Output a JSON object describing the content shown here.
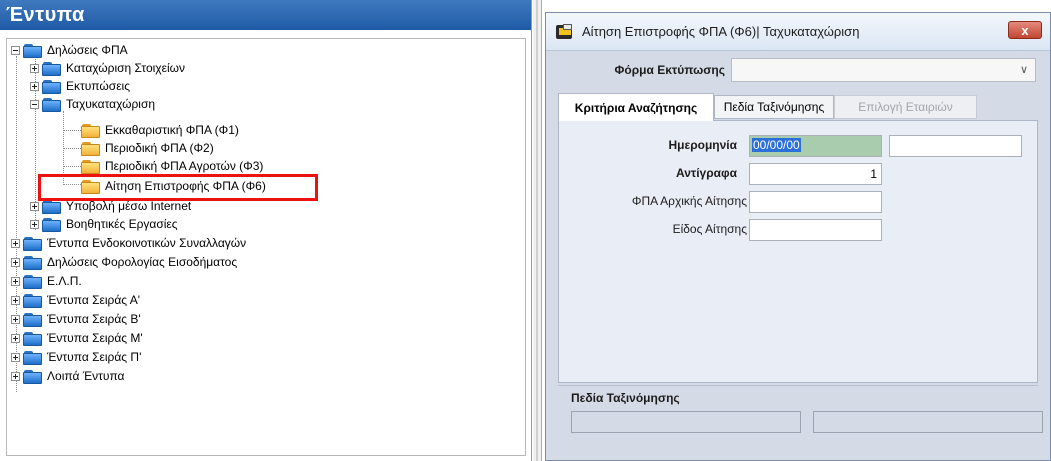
{
  "left_panel": {
    "title": "Έντυπα",
    "tree": [
      {
        "label": "Δηλώσεις ΦΠΑ",
        "level": 0,
        "expander": "minus",
        "folder": "blue"
      },
      {
        "label": "Καταχώριση Στοιχείων",
        "level": 1,
        "expander": "plus",
        "folder": "blue"
      },
      {
        "label": "Εκτυπώσεις",
        "level": 1,
        "expander": "plus",
        "folder": "blue"
      },
      {
        "label": "Ταχυκαταχώριση",
        "level": 1,
        "expander": "minus",
        "folder": "blue"
      },
      {
        "label": "Εκκαθαριστική ΦΠΑ (Φ1)",
        "level": 2,
        "expander": "none",
        "folder": "orange"
      },
      {
        "label": "Περιοδική ΦΠΑ (Φ2)",
        "level": 2,
        "expander": "none",
        "folder": "orange"
      },
      {
        "label": "Περιοδική ΦΠΑ Αγροτών (Φ3)",
        "level": 2,
        "expander": "none",
        "folder": "orange"
      },
      {
        "label": "Αίτηση Επιστροφής ΦΠΑ (Φ6)",
        "level": 2,
        "expander": "none",
        "folder": "orange",
        "highlighted": true
      },
      {
        "label": "Υποβολή μέσω Internet",
        "level": 1,
        "expander": "plus",
        "folder": "blue"
      },
      {
        "label": "Βοηθητικές Εργασίες",
        "level": 1,
        "expander": "plus",
        "folder": "blue"
      },
      {
        "label": "Έντυπα Ενδοκοινοτικών Συναλλαγών",
        "level": 0,
        "expander": "plus",
        "folder": "blue"
      },
      {
        "label": "Δηλώσεις Φορολογίας Εισοδήματος",
        "level": 0,
        "expander": "plus",
        "folder": "blue"
      },
      {
        "label": "Ε.Λ.Π.",
        "level": 0,
        "expander": "plus",
        "folder": "blue"
      },
      {
        "label": "Έντυπα Σειράς Α'",
        "level": 0,
        "expander": "plus",
        "folder": "blue"
      },
      {
        "label": "Έντυπα Σειράς Β'",
        "level": 0,
        "expander": "plus",
        "folder": "blue"
      },
      {
        "label": "Έντυπα Σειράς Μ'",
        "level": 0,
        "expander": "plus",
        "folder": "blue"
      },
      {
        "label": "Έντυπα Σειράς Π'",
        "level": 0,
        "expander": "plus",
        "folder": "blue"
      },
      {
        "label": "Λοιπά Έντυπα",
        "level": 0,
        "expander": "plus",
        "folder": "blue"
      }
    ]
  },
  "dialog": {
    "title": "Αίτηση Επιστροφής ΦΠΑ (Φ6)| Ταχυκαταχώριση",
    "close_label": "x",
    "print_form_label": "Φόρμα Εκτύπωσης",
    "print_form_value": "",
    "tabs": [
      {
        "label": "Κριτήρια Αναζήτησης",
        "state": "active"
      },
      {
        "label": "Πεδία Ταξινόμησης",
        "state": "normal"
      },
      {
        "label": "Επιλογή Εταιριών",
        "state": "disabled"
      }
    ],
    "fields": {
      "date_label": "Ημερομηνία",
      "date_value": "00/00/00",
      "date_extra_value": "",
      "copies_label": "Αντίγραφα",
      "copies_value": "1",
      "initial_vat_label": "ΦΠΑ Αρχικής Αίτησης",
      "initial_vat_value": "",
      "request_type_label": "Είδος Αίτησης",
      "request_type_value": ""
    },
    "sort_fields_label": "Πεδία Ταξινόμησης",
    "sort_field_1": "",
    "sort_field_2": ""
  },
  "colors": {
    "header_blue": "#2a63ad",
    "highlight_red": "#ee1111",
    "date_field_green": "#a9ccae",
    "selection_blue": "#2b6fd8",
    "dialog_background": "#d4dbe6"
  }
}
